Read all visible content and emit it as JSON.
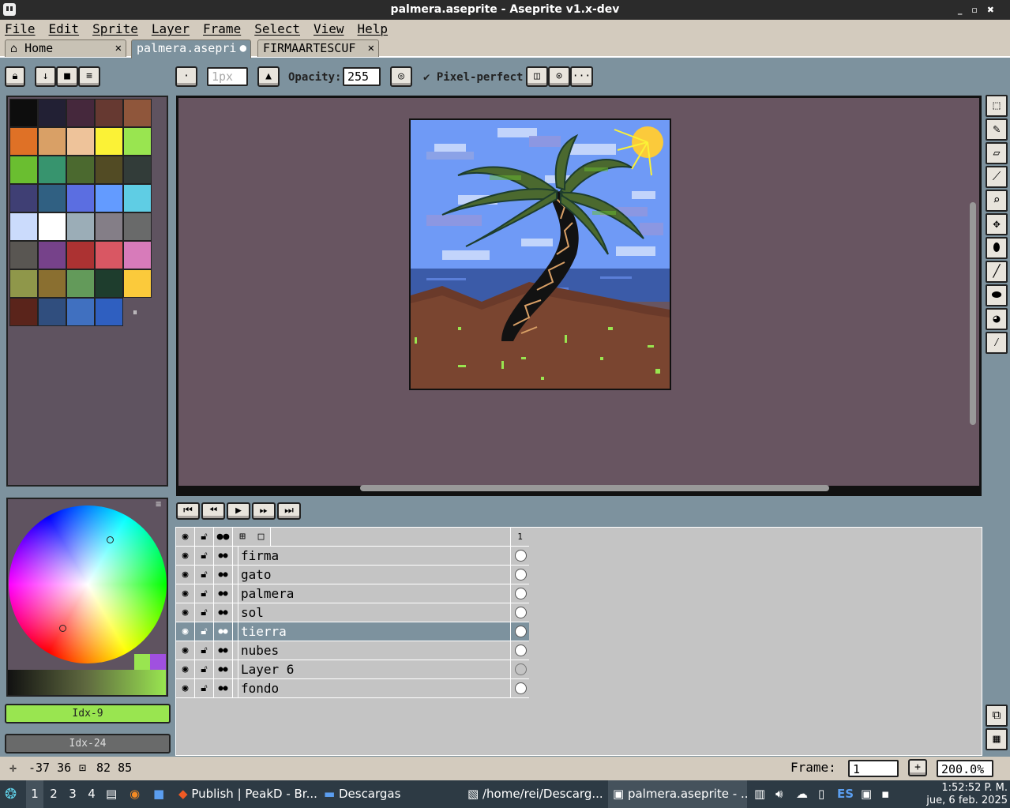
{
  "window": {
    "title": "palmera.aseprite - Aseprite v1.x-dev",
    "min": "_",
    "max": "▫",
    "close": "✖"
  },
  "menu": [
    "File",
    "Edit",
    "Sprite",
    "Layer",
    "Frame",
    "Select",
    "View",
    "Help"
  ],
  "tabs": [
    {
      "label": "Home",
      "icon": "home-icon",
      "close": "✕"
    },
    {
      "label": "palmera.asepri",
      "modified": "●"
    },
    {
      "label": "FIRMAARTESCUF",
      "close": "✕"
    }
  ],
  "toolbar": {
    "brush_size": "1px",
    "opacity_label": "Opacity:",
    "opacity_value": "255",
    "pixel_perfect_check": "✔",
    "pixel_perfect_label": "Pixel-perfect",
    "more": "···"
  },
  "palette_colors": [
    "#0d0d0d",
    "#222034",
    "#45283c",
    "#663931",
    "#8f563b",
    "#df7126",
    "#d9a066",
    "#eec39a",
    "#fbf236",
    "#99e550",
    "#6abe30",
    "#37946e",
    "#4b692f",
    "#524b24",
    "#323c39",
    "#3f3f74",
    "#306082",
    "#5b6ee1",
    "#639bff",
    "#5fcde4",
    "#cbdbfc",
    "#ffffff",
    "#9badb7",
    "#847e87",
    "#696a6a",
    "#595652",
    "#76428a",
    "#ac3232",
    "#d95763",
    "#d77bba",
    "#8f974a",
    "#8a6f30",
    "#639a5a",
    "#1e3d2d",
    "#fbca3b",
    "#5a241b",
    "#304e7e",
    "#4070c0",
    "#2f5fc0"
  ],
  "color_bars": {
    "fg": "Idx-9",
    "bg": "Idx-24",
    "fg_color": "#99e550",
    "bg_color": "#696a6a"
  },
  "layers": {
    "frame_header": "1",
    "rows": [
      {
        "name": "firma",
        "selected": false,
        "cel": "full"
      },
      {
        "name": "gato",
        "selected": false,
        "cel": "full"
      },
      {
        "name": "palmera",
        "selected": false,
        "cel": "full"
      },
      {
        "name": "sol",
        "selected": false,
        "cel": "full"
      },
      {
        "name": "tierra",
        "selected": true,
        "cel": "full"
      },
      {
        "name": "nubes",
        "selected": false,
        "cel": "full"
      },
      {
        "name": "Layer 6",
        "selected": false,
        "cel": "empty"
      },
      {
        "name": "fondo",
        "selected": false,
        "cel": "full"
      }
    ]
  },
  "status": {
    "cursor_pos": "-37 36",
    "selection_size": "82 85",
    "frame_label": "Frame:",
    "frame_value": "1",
    "zoom": "200.0%"
  },
  "taskbar": {
    "workspaces": [
      "1",
      "2",
      "3",
      "4"
    ],
    "apps": [
      {
        "label": "Publish | PeakD - Br..."
      },
      {
        "label": "Descargas"
      },
      {
        "label": "/home/rei/Descarg..."
      },
      {
        "label": "palmera.aseprite - ..."
      }
    ],
    "lang": "ES",
    "time": "1:52:52 P. M.",
    "date": "jue, 6 feb. 2025"
  }
}
